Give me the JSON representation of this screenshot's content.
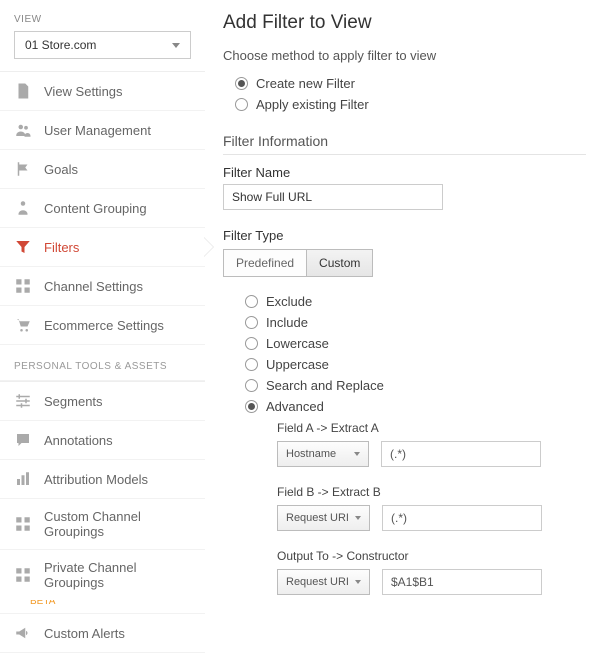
{
  "sidebar": {
    "view_label": "VIEW",
    "view_value": "01 Store.com",
    "items": [
      {
        "label": "View Settings"
      },
      {
        "label": "User Management"
      },
      {
        "label": "Goals"
      },
      {
        "label": "Content Grouping"
      },
      {
        "label": "Filters"
      },
      {
        "label": "Channel Settings"
      },
      {
        "label": "Ecommerce Settings"
      }
    ],
    "section2_label": "PERSONAL TOOLS & ASSETS",
    "items2": [
      {
        "label": "Segments"
      },
      {
        "label": "Annotations"
      },
      {
        "label": "Attribution Models"
      },
      {
        "label": "Custom Channel Groupings"
      },
      {
        "label": "Private Channel Groupings",
        "beta": "BETA"
      },
      {
        "label": "Custom Alerts"
      }
    ]
  },
  "main": {
    "title": "Add Filter to View",
    "method_label": "Choose method to apply filter to view",
    "method_options": [
      "Create new Filter",
      "Apply existing Filter"
    ],
    "method_selected": 0,
    "filter_info_heading": "Filter Information",
    "filter_name_label": "Filter Name",
    "filter_name_value": "Show Full URL",
    "filter_type_label": "Filter Type",
    "tabs": [
      "Predefined",
      "Custom"
    ],
    "tab_selected": 1,
    "custom_options": [
      "Exclude",
      "Include",
      "Lowercase",
      "Uppercase",
      "Search and Replace",
      "Advanced"
    ],
    "custom_selected": 5,
    "adv": {
      "fieldA_label": "Field A -> Extract A",
      "fieldA_select": "Hostname",
      "fieldA_value": "(.*)",
      "fieldB_label": "Field B -> Extract B",
      "fieldB_select": "Request URI",
      "fieldB_value": "(.*)",
      "out_label": "Output To -> Constructor",
      "out_select": "Request URI",
      "out_value": "$A1$B1"
    }
  }
}
